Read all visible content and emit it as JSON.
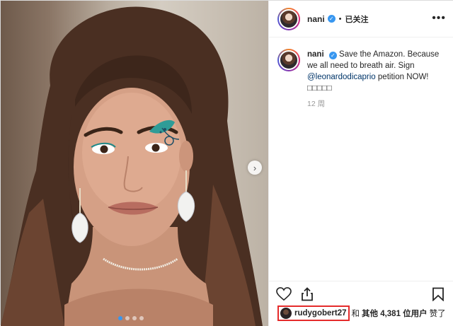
{
  "post": {
    "username": "nani",
    "verified_mark": "✓",
    "separator": "•",
    "follow_label": "已关注",
    "more_label": "•••",
    "caption": {
      "username": "nani",
      "text_before": "Save the Amazon. Because we all need to breath air. Sign ",
      "mention": "@leonardodicaprio",
      "text_after": " petition NOW! □□□□□"
    },
    "time": "12 周",
    "next_arrow": "›",
    "carousel": {
      "count": 4,
      "active_index": 0
    },
    "likes": {
      "liker": "rudygobert27",
      "and": "和",
      "others": "其他 4,381 位用户",
      "liked": "赞了"
    },
    "colors": {
      "accent": "#3897f0",
      "highlight": "#e52b2b",
      "mention": "#003569"
    },
    "icons": [
      "heart-icon",
      "share-icon",
      "bookmark-icon",
      "chevron-right-icon",
      "verified-badge-icon",
      "more-options-icon"
    ]
  }
}
